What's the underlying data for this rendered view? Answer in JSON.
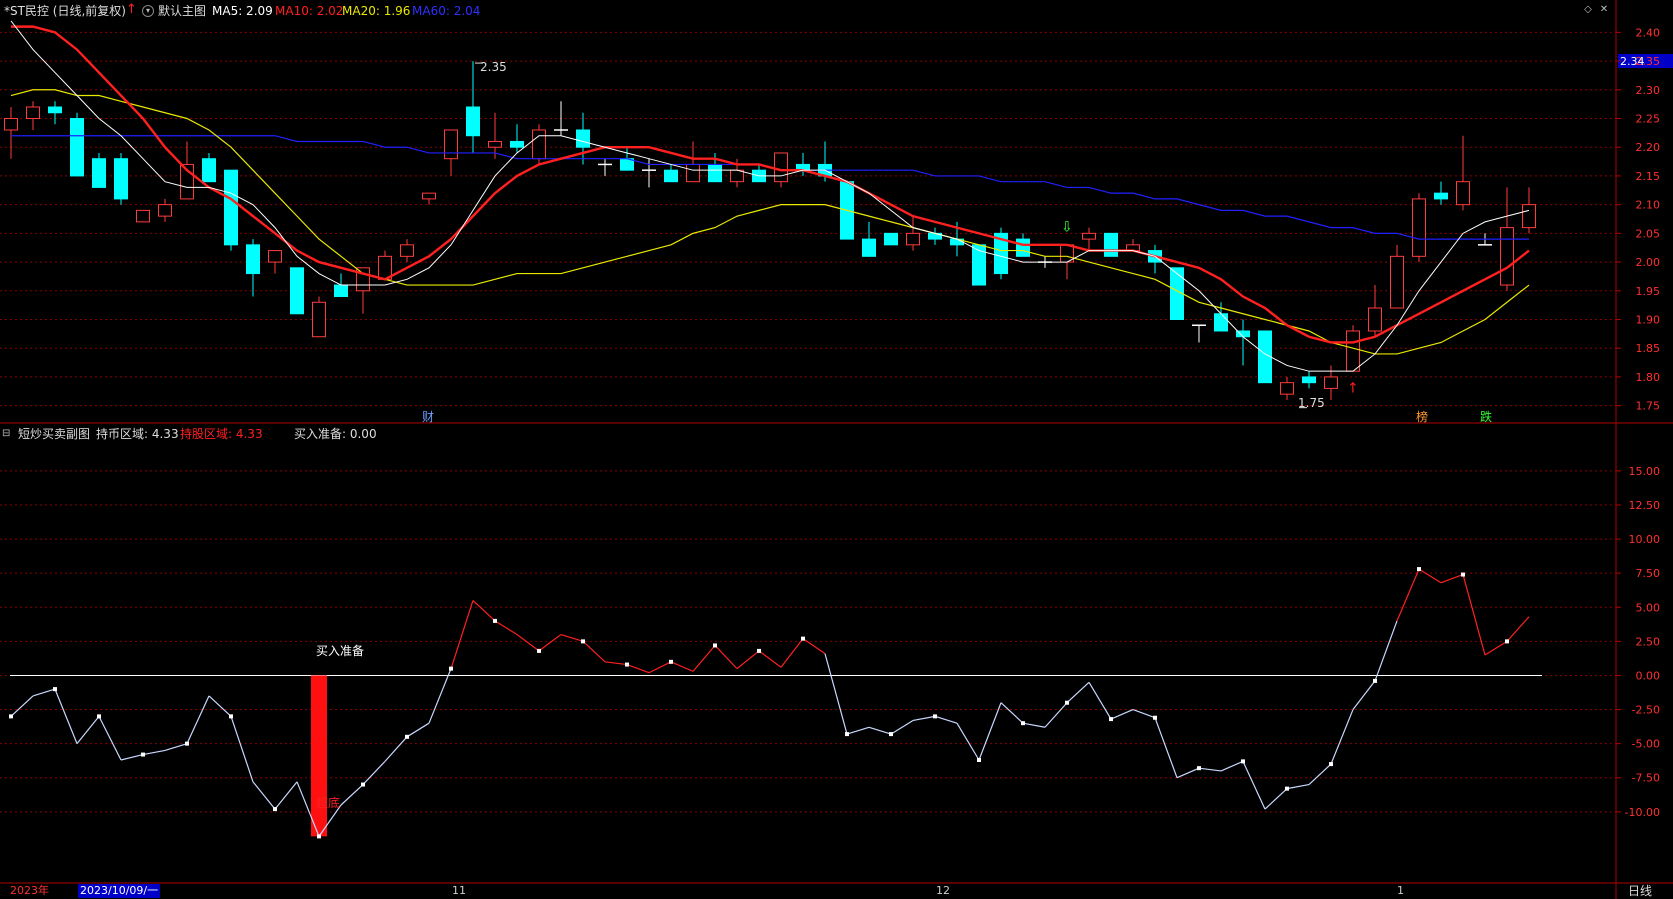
{
  "header": {
    "stock_title": "*ST民控 (日线,前复权)",
    "main_chart_label": "默认主图",
    "ma5": "MA5: 2.09",
    "ma10": "MA10: 2.02",
    "ma20": "MA20: 1.96",
    "ma60": "MA60: 2.04",
    "colors": {
      "ma5": "#ffffff",
      "ma10": "#ff2020",
      "ma20": "#e8e800",
      "ma60": "#2020ff"
    }
  },
  "main_panel": {
    "price_axis": [
      "2.40",
      "2.35",
      "2.30",
      "2.25",
      "2.20",
      "2.15",
      "2.10",
      "2.05",
      "2.00",
      "1.95",
      "1.90",
      "1.85",
      "1.80",
      "1.75"
    ],
    "current_price_tag": "2.34",
    "high_label": "2.35",
    "low_label": "1.75",
    "markers": {
      "cai": "财",
      "bang": "榜",
      "die": "跌"
    }
  },
  "sub_panel": {
    "title": "短炒买卖副图",
    "hold_coin": "持币区域: 4.33",
    "hold_stock": "持股区域: 4.33",
    "buy_ready": "买入准备: 0.00",
    "buy_ready_label": "买入准备",
    "bottom_label": "超底",
    "axis": [
      "15.00",
      "12.50",
      "10.00",
      "7.50",
      "5.00",
      "2.50",
      "0.00",
      "-2.50",
      "-5.00",
      "-7.50",
      "-10.00"
    ]
  },
  "time_axis": {
    "year": "2023年",
    "cursor_date": "2023/10/09/一",
    "months": [
      "11",
      "12",
      "1"
    ],
    "period": "日线"
  },
  "chart_data": {
    "type": "candlestick",
    "ylim": [
      1.725,
      2.425
    ],
    "candles": [
      [
        2.23,
        2.27,
        2.18,
        2.25
      ],
      [
        2.25,
        2.28,
        2.23,
        2.27
      ],
      [
        2.27,
        2.28,
        2.24,
        2.26
      ],
      [
        2.25,
        2.26,
        2.15,
        2.15
      ],
      [
        2.18,
        2.19,
        2.13,
        2.13
      ],
      [
        2.18,
        2.19,
        2.1,
        2.11
      ],
      [
        2.07,
        2.09,
        2.07,
        2.09
      ],
      [
        2.08,
        2.11,
        2.07,
        2.1
      ],
      [
        2.11,
        2.21,
        2.11,
        2.17
      ],
      [
        2.18,
        2.19,
        2.14,
        2.14
      ],
      [
        2.16,
        2.16,
        2.02,
        2.03
      ],
      [
        2.03,
        2.04,
        1.94,
        1.98
      ],
      [
        2.0,
        2.02,
        1.98,
        2.02
      ],
      [
        1.99,
        1.99,
        1.91,
        1.91
      ],
      [
        1.87,
        1.94,
        1.87,
        1.93
      ],
      [
        1.96,
        1.98,
        1.94,
        1.94
      ],
      [
        1.95,
        1.99,
        1.91,
        1.99
      ],
      [
        1.97,
        2.02,
        1.97,
        2.01
      ],
      [
        2.01,
        2.04,
        2.0,
        2.03
      ],
      [
        2.11,
        2.12,
        2.1,
        2.12
      ],
      [
        2.18,
        2.22,
        2.15,
        2.23
      ],
      [
        2.27,
        2.35,
        2.19,
        2.22
      ],
      [
        2.2,
        2.26,
        2.18,
        2.21
      ],
      [
        2.21,
        2.24,
        2.19,
        2.2
      ],
      [
        2.18,
        2.24,
        2.17,
        2.23
      ],
      [
        2.23,
        2.28,
        2.22,
        2.23
      ],
      [
        2.23,
        2.26,
        2.17,
        2.2
      ],
      [
        2.17,
        2.18,
        2.15,
        2.17
      ],
      [
        2.18,
        2.2,
        2.16,
        2.16
      ],
      [
        2.16,
        2.18,
        2.13,
        2.16
      ],
      [
        2.16,
        2.17,
        2.14,
        2.14
      ],
      [
        2.14,
        2.21,
        2.14,
        2.17
      ],
      [
        2.17,
        2.19,
        2.14,
        2.14
      ],
      [
        2.14,
        2.18,
        2.13,
        2.16
      ],
      [
        2.16,
        2.17,
        2.14,
        2.14
      ],
      [
        2.14,
        2.18,
        2.13,
        2.19
      ],
      [
        2.17,
        2.19,
        2.15,
        2.16
      ],
      [
        2.17,
        2.21,
        2.14,
        2.15
      ],
      [
        2.14,
        2.14,
        2.04,
        2.04
      ],
      [
        2.04,
        2.07,
        2.01,
        2.01
      ],
      [
        2.05,
        2.05,
        2.03,
        2.03
      ],
      [
        2.03,
        2.08,
        2.02,
        2.05
      ],
      [
        2.05,
        2.06,
        2.03,
        2.04
      ],
      [
        2.04,
        2.07,
        2.01,
        2.03
      ],
      [
        2.03,
        2.03,
        1.96,
        1.96
      ],
      [
        2.05,
        2.06,
        1.97,
        1.98
      ],
      [
        2.04,
        2.05,
        2.01,
        2.01
      ],
      [
        2.0,
        2.01,
        1.99,
        2.0
      ],
      [
        2.0,
        2.03,
        1.97,
        2.03
      ],
      [
        2.04,
        2.06,
        2.02,
        2.05
      ],
      [
        2.05,
        2.05,
        2.01,
        2.01
      ],
      [
        2.02,
        2.04,
        2.02,
        2.03
      ],
      [
        2.02,
        2.03,
        1.98,
        2.0
      ],
      [
        1.99,
        1.99,
        1.9,
        1.9
      ],
      [
        1.89,
        1.89,
        1.86,
        1.89
      ],
      [
        1.91,
        1.93,
        1.88,
        1.88
      ],
      [
        1.88,
        1.9,
        1.82,
        1.87
      ],
      [
        1.88,
        1.88,
        1.79,
        1.79
      ],
      [
        1.77,
        1.8,
        1.76,
        1.79
      ],
      [
        1.8,
        1.81,
        1.78,
        1.79
      ],
      [
        1.78,
        1.82,
        1.76,
        1.8
      ],
      [
        1.81,
        1.89,
        1.81,
        1.88
      ],
      [
        1.88,
        1.96,
        1.87,
        1.92
      ],
      [
        1.92,
        2.03,
        1.92,
        2.01
      ],
      [
        2.01,
        2.12,
        2.0,
        2.11
      ],
      [
        2.12,
        2.14,
        2.1,
        2.11
      ],
      [
        2.1,
        2.22,
        2.09,
        2.14
      ],
      [
        2.03,
        2.05,
        2.03,
        2.03
      ],
      [
        1.96,
        2.13,
        1.95,
        2.06
      ],
      [
        2.06,
        2.13,
        2.05,
        2.1
      ]
    ],
    "ma5": [
      2.42,
      2.37,
      2.33,
      2.29,
      2.25,
      2.22,
      2.18,
      2.14,
      2.13,
      2.13,
      2.12,
      2.1,
      2.06,
      2.01,
      1.98,
      1.96,
      1.96,
      1.96,
      1.97,
      1.99,
      2.03,
      2.09,
      2.15,
      2.19,
      2.22,
      2.22,
      2.21,
      2.2,
      2.19,
      2.18,
      2.17,
      2.16,
      2.16,
      2.16,
      2.15,
      2.15,
      2.16,
      2.16,
      2.14,
      2.12,
      2.09,
      2.06,
      2.05,
      2.04,
      2.02,
      2.01,
      2.0,
      2.0,
      2.0,
      2.02,
      2.02,
      2.02,
      2.01,
      1.98,
      1.95,
      1.91,
      1.87,
      1.84,
      1.82,
      1.81,
      1.81,
      1.81,
      1.84,
      1.89,
      1.95,
      2.0,
      2.05,
      2.07,
      2.08,
      2.09
    ],
    "ma10": [
      2.41,
      2.41,
      2.4,
      2.37,
      2.33,
      2.29,
      2.25,
      2.2,
      2.16,
      2.13,
      2.11,
      2.08,
      2.05,
      2.02,
      2.0,
      1.99,
      1.98,
      1.97,
      1.99,
      2.01,
      2.04,
      2.08,
      2.12,
      2.15,
      2.17,
      2.18,
      2.19,
      2.2,
      2.2,
      2.2,
      2.19,
      2.18,
      2.18,
      2.17,
      2.17,
      2.16,
      2.16,
      2.15,
      2.14,
      2.12,
      2.1,
      2.08,
      2.07,
      2.06,
      2.05,
      2.04,
      2.03,
      2.03,
      2.03,
      2.02,
      2.02,
      2.02,
      2.01,
      2.0,
      1.99,
      1.97,
      1.94,
      1.92,
      1.89,
      1.87,
      1.86,
      1.86,
      1.87,
      1.89,
      1.91,
      1.93,
      1.95,
      1.97,
      1.99,
      2.02
    ],
    "ma20": [
      2.29,
      2.3,
      2.3,
      2.29,
      2.29,
      2.28,
      2.27,
      2.26,
      2.25,
      2.23,
      2.2,
      2.16,
      2.12,
      2.08,
      2.04,
      2.01,
      1.98,
      1.97,
      1.96,
      1.96,
      1.96,
      1.96,
      1.97,
      1.98,
      1.98,
      1.98,
      1.99,
      2.0,
      2.01,
      2.02,
      2.03,
      2.05,
      2.06,
      2.08,
      2.09,
      2.1,
      2.1,
      2.1,
      2.09,
      2.08,
      2.07,
      2.06,
      2.05,
      2.04,
      2.03,
      2.02,
      2.02,
      2.01,
      2.01,
      2.0,
      1.99,
      1.98,
      1.97,
      1.95,
      1.93,
      1.92,
      1.91,
      1.9,
      1.89,
      1.88,
      1.86,
      1.85,
      1.84,
      1.84,
      1.85,
      1.86,
      1.88,
      1.9,
      1.93,
      1.96
    ],
    "ma60": [
      2.22,
      2.22,
      2.22,
      2.22,
      2.22,
      2.22,
      2.22,
      2.22,
      2.22,
      2.22,
      2.22,
      2.22,
      2.22,
      2.21,
      2.21,
      2.21,
      2.21,
      2.2,
      2.2,
      2.19,
      2.19,
      2.19,
      2.19,
      2.18,
      2.18,
      2.18,
      2.18,
      2.18,
      2.18,
      2.17,
      2.17,
      2.17,
      2.17,
      2.17,
      2.17,
      2.16,
      2.16,
      2.16,
      2.16,
      2.16,
      2.16,
      2.16,
      2.15,
      2.15,
      2.15,
      2.14,
      2.14,
      2.14,
      2.13,
      2.13,
      2.12,
      2.12,
      2.11,
      2.11,
      2.1,
      2.09,
      2.09,
      2.08,
      2.08,
      2.07,
      2.06,
      2.06,
      2.05,
      2.05,
      2.04,
      2.04,
      2.04,
      2.04,
      2.04,
      2.04
    ],
    "sub": {
      "ylim": [
        -15,
        18
      ],
      "values": [
        -3.0,
        -1.5,
        -1.0,
        -5.0,
        -3.0,
        -6.2,
        -5.8,
        -5.5,
        -5.0,
        -1.5,
        -3.0,
        -7.8,
        -9.8,
        -7.8,
        -11.8,
        -9.5,
        -8.0,
        -6.3,
        -4.5,
        -3.5,
        0.5,
        5.5,
        4.0,
        3.0,
        1.8,
        3.0,
        2.5,
        1.0,
        0.8,
        0.2,
        1.0,
        0.3,
        2.2,
        0.5,
        1.8,
        0.6,
        2.7,
        1.6,
        -4.3,
        -3.8,
        -4.3,
        -3.3,
        -3.0,
        -3.5,
        -6.2,
        -2.0,
        -3.5,
        -3.8,
        -2.0,
        -0.5,
        -3.2,
        -2.5,
        -3.1,
        -7.5,
        -6.8,
        -7.0,
        -6.3,
        -9.8,
        -8.3,
        -8.0,
        -6.5,
        -2.5,
        -0.4,
        4.0,
        7.8,
        6.8,
        7.4,
        1.5,
        2.5,
        4.3
      ],
      "red_bar_index": 14
    }
  }
}
